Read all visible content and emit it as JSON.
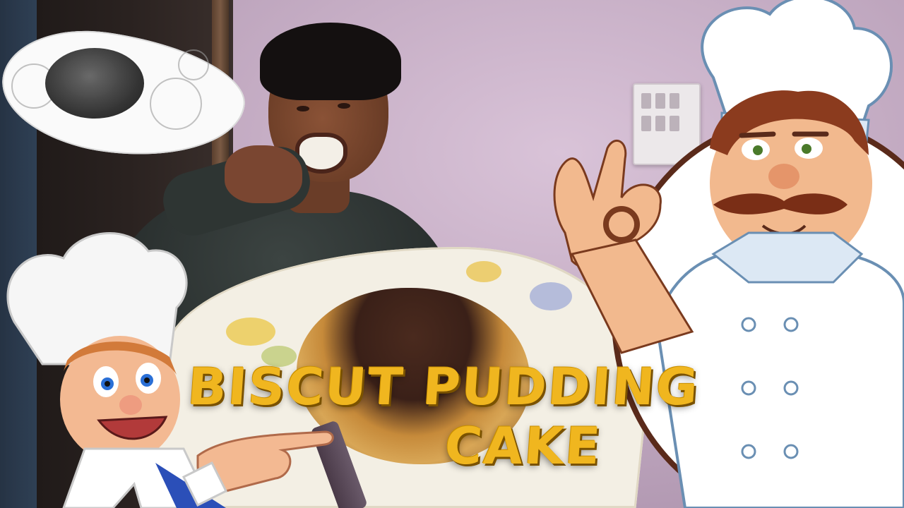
{
  "thumbnail": {
    "title_line1": "BISCUT PUDDING",
    "title_line2": "CAKE",
    "title_color": "#f0b61f"
  },
  "scene": {
    "photo_subject": "person eating cake",
    "icons": [
      "chef-okay-gesture-icon",
      "chef-pointing-icon"
    ]
  }
}
